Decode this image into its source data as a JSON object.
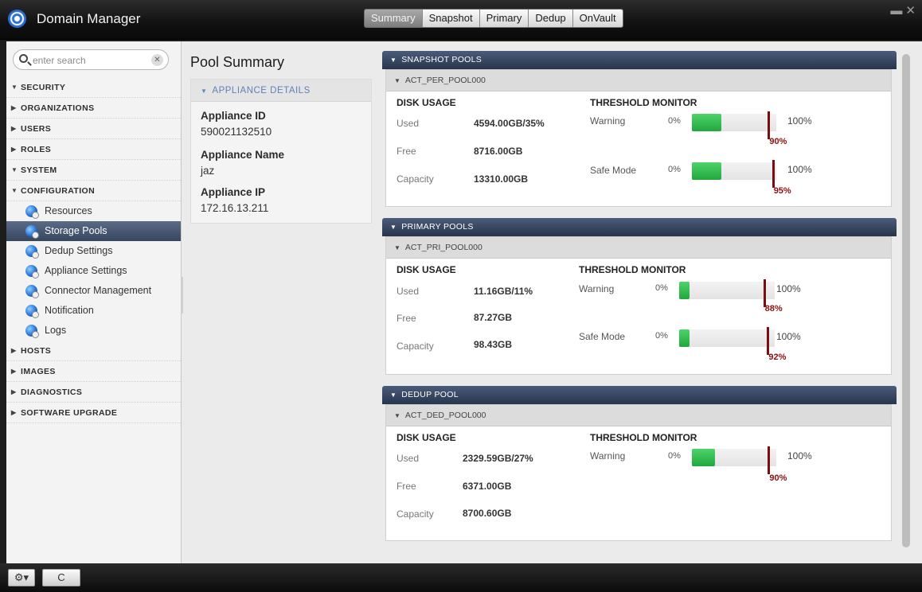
{
  "app": {
    "title": "Domain Manager"
  },
  "tabs": [
    "Summary",
    "Snapshot",
    "Primary",
    "Dedup",
    "OnVault"
  ],
  "active_tab": "Summary",
  "search": {
    "placeholder": "enter search",
    "value": ""
  },
  "sidebar": {
    "security": "SECURITY",
    "organizations": "ORGANIZATIONS",
    "users": "USERS",
    "roles": "ROLES",
    "system": "SYSTEM",
    "configuration": "CONFIGURATION",
    "config_items": [
      "Resources",
      "Storage Pools",
      "Dedup Settings",
      "Appliance Settings",
      "Connector Management",
      "Notification",
      "Logs"
    ],
    "selected_item": "Storage Pools",
    "hosts": "HOSTS",
    "images": "IMAGES",
    "diagnostics": "DIAGNOSTICS",
    "software_upgrade": "SOFTWARE UPGRADE"
  },
  "summary": {
    "title": "Pool Summary",
    "appliance_header": "APPLIANCE DETAILS",
    "appliance_id_label": "Appliance ID",
    "appliance_id": "590021132510",
    "appliance_name_label": "Appliance Name",
    "appliance_name": "jaz",
    "appliance_ip_label": "Appliance IP",
    "appliance_ip": "172.16.13.211"
  },
  "labels": {
    "disk_usage": "DISK USAGE",
    "threshold_monitor": "THRESHOLD MONITOR",
    "used": "Used",
    "free": "Free",
    "capacity": "Capacity",
    "warning": "Warning",
    "safe_mode": "Safe Mode",
    "zero": "0%",
    "hundred": "100%"
  },
  "pools": [
    {
      "header": "SNAPSHOT POOLS",
      "name": "ACT_PER_POOL000",
      "used": "4594.00GB/35%",
      "free": "8716.00GB",
      "capacity": "13310.00GB",
      "warning_fill_pct": 35,
      "warning_threshold": "90%",
      "warning_threshold_pct": 90,
      "safe_fill_pct": 35,
      "safe_threshold": "95%",
      "safe_threshold_pct": 95
    },
    {
      "header": "PRIMARY POOLS",
      "name": "ACT_PRI_POOL000",
      "used": "11.16GB/11%",
      "free": "87.27GB",
      "capacity": "98.43GB",
      "warning_fill_pct": 11,
      "warning_threshold": "88%",
      "warning_threshold_pct": 88,
      "safe_fill_pct": 11,
      "safe_threshold": "92%",
      "safe_threshold_pct": 92
    },
    {
      "header": "DEDUP POOL",
      "name": "ACT_DED_POOL000",
      "used": "2329.59GB/27%",
      "free": "6371.00GB",
      "capacity": "8700.60GB",
      "warning_fill_pct": 27,
      "warning_threshold": "90%",
      "warning_threshold_pct": 90
    }
  ],
  "icons": {
    "settings": "gear-icon",
    "refresh": "refresh-icon",
    "refresh_glyph": "C",
    "settings_glyph": "⚙▾"
  }
}
